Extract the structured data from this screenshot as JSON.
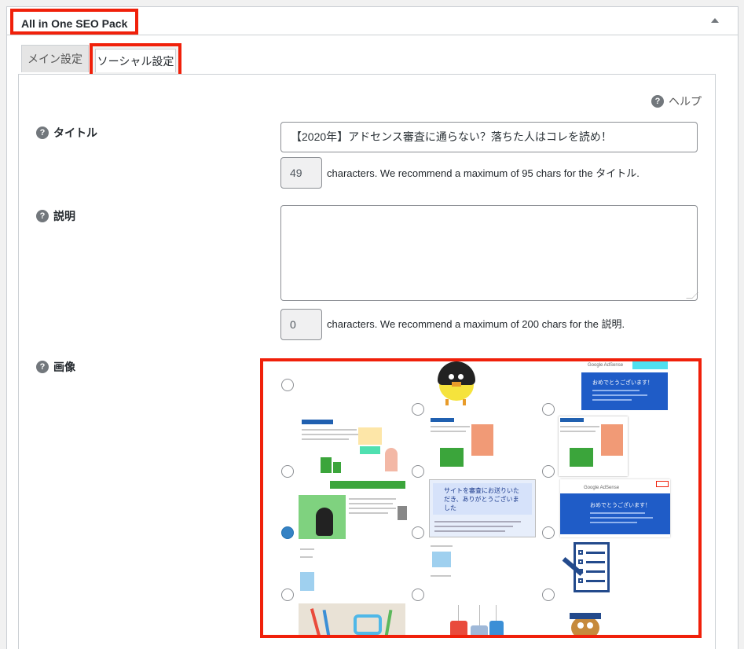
{
  "postbox": {
    "title": "All in One SEO Pack"
  },
  "tabs": [
    {
      "label": "メイン設定"
    },
    {
      "label": "ソーシャル設定"
    }
  ],
  "help": {
    "label": "ヘルプ",
    "icon": "question-circle-icon"
  },
  "fields": {
    "title": {
      "label": "タイトル",
      "value": "【2020年】アドセンス審査に通らない？落ちた人はコレを読め！",
      "count": "49",
      "count_text": "characters. We recommend a maximum of 95 chars for the タイトル."
    },
    "description": {
      "label": "説明",
      "value": "",
      "count": "0",
      "count_text": "characters. We recommend a maximum of 200 chars for the 説明."
    },
    "image": {
      "label": "画像",
      "selected_index": 6,
      "options": [
        {
          "name": "none"
        },
        {
          "name": "darth-chick-mascot"
        },
        {
          "name": "adsense-approval-email"
        },
        {
          "name": "blog-screenshot-1"
        },
        {
          "name": "blog-screenshot-2"
        },
        {
          "name": "blog-screenshot-3"
        },
        {
          "name": "green-site-banner"
        },
        {
          "name": "adsense-notice-card"
        },
        {
          "name": "adsense-approval-email-2"
        },
        {
          "name": "checklist-document"
        },
        {
          "name": "pencils-photo"
        },
        {
          "name": "tags-illustration"
        },
        {
          "name": "owl-mascot"
        }
      ],
      "thumb_texts": {
        "adsense_header": "Google AdSense",
        "congrats": "おめでとうございます！",
        "site_thanks": "サイトを審査にお送りいただき、ありがとうございました"
      }
    }
  },
  "colors": {
    "highlight": "#f0200a",
    "accent": "#3582c4"
  }
}
